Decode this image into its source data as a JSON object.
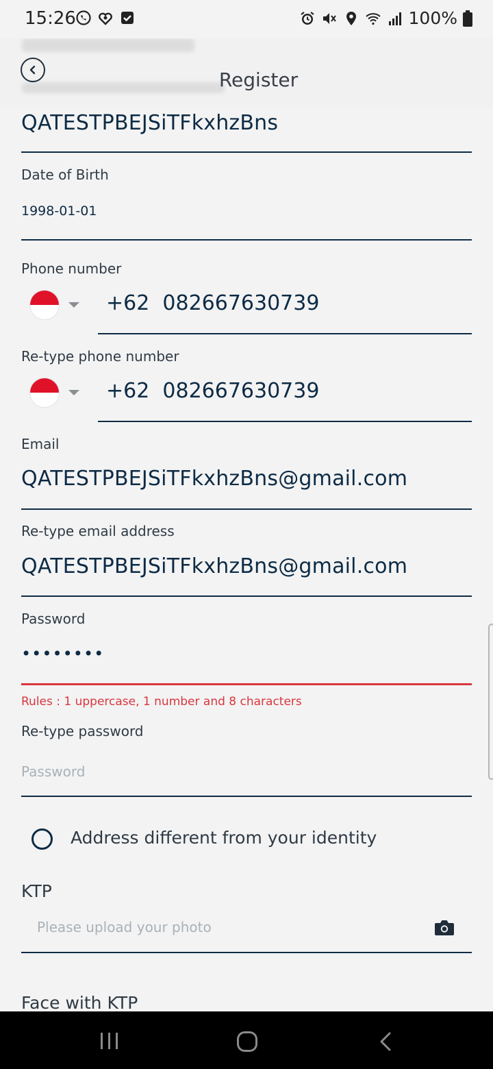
{
  "status_bar": {
    "time": "15:26",
    "battery": "100%",
    "left_icons": [
      "whatsapp-icon",
      "app-heart-icon",
      "checkbox-icon"
    ],
    "right_icons": [
      "alarm-icon",
      "mute-icon",
      "location-icon",
      "wifi-icon",
      "signal-icon",
      "battery-icon"
    ]
  },
  "header": {
    "title": "Register",
    "back_icon": "chevron-left-circle-icon"
  },
  "form": {
    "name_value": "QATESTPBEJSiTFkxhzBns",
    "dob_label": "Date of Birth",
    "dob_value": "1998-01-01",
    "phone_label": "Phone number",
    "phone_code": "+62",
    "phone_value": "082667630739",
    "retype_phone_label": "Re-type phone number",
    "retype_phone_code": "+62",
    "retype_phone_value": "082667630739",
    "email_label": "Email",
    "email_value": "QATESTPBEJSiTFkxhzBns@gmail.com",
    "retype_email_label": "Re-type email address",
    "retype_email_value": "QATESTPBEJSiTFkxhzBns@gmail.com",
    "password_label": "Password",
    "password_value": "••••••••",
    "password_error": "Rules : 1 uppercase, 1 number and 8 characters",
    "retype_password_label": "Re-type password",
    "retype_password_placeholder": "Password",
    "address_option_label": "Address different from your identity",
    "ktp_label": "KTP",
    "ktp_placeholder": "Please upload your photo",
    "face_ktp_label": "Face with KTP"
  },
  "colors": {
    "primary": "#0d2b45",
    "error": "#d9363e",
    "flag_red": "#e0122a"
  },
  "nav_bar": {
    "icons": [
      "recent-apps-icon",
      "home-icon",
      "back-icon"
    ]
  }
}
